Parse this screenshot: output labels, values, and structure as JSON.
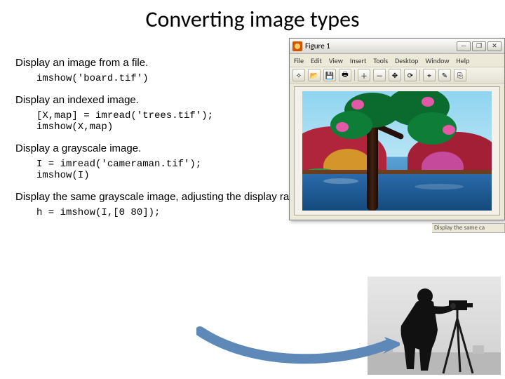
{
  "title": "Converting image types",
  "sections": {
    "s1": {
      "desc": "Display an image from a file.",
      "code": "imshow('board.tif')"
    },
    "s2": {
      "desc": "Display an indexed image.",
      "code": "[X,map] = imread('trees.tif');\nimshow(X,map)"
    },
    "s3": {
      "desc": "Display a grayscale image.",
      "code": "I = imread('cameraman.tif');\nimshow(I)"
    },
    "s4": {
      "desc": "Display the same grayscale image, adjusting the display range.",
      "code": "h = imshow(I,[0 80]);"
    }
  },
  "figwin": {
    "title": "Figure 1",
    "menus": [
      "File",
      "Edit",
      "View",
      "Insert",
      "Tools",
      "Desktop",
      "Window",
      "Help"
    ],
    "winbtns": {
      "min": "—",
      "max": "❐",
      "close": "✕"
    },
    "toolbar_icons": [
      "new",
      "open",
      "save",
      "print",
      "sep",
      "zoom-in",
      "zoom-out",
      "pan",
      "rotate",
      "sep",
      "data-cursor",
      "brush",
      "link",
      "sep",
      "colorbar",
      "legend"
    ]
  },
  "caption_cut": "Display the same ca"
}
